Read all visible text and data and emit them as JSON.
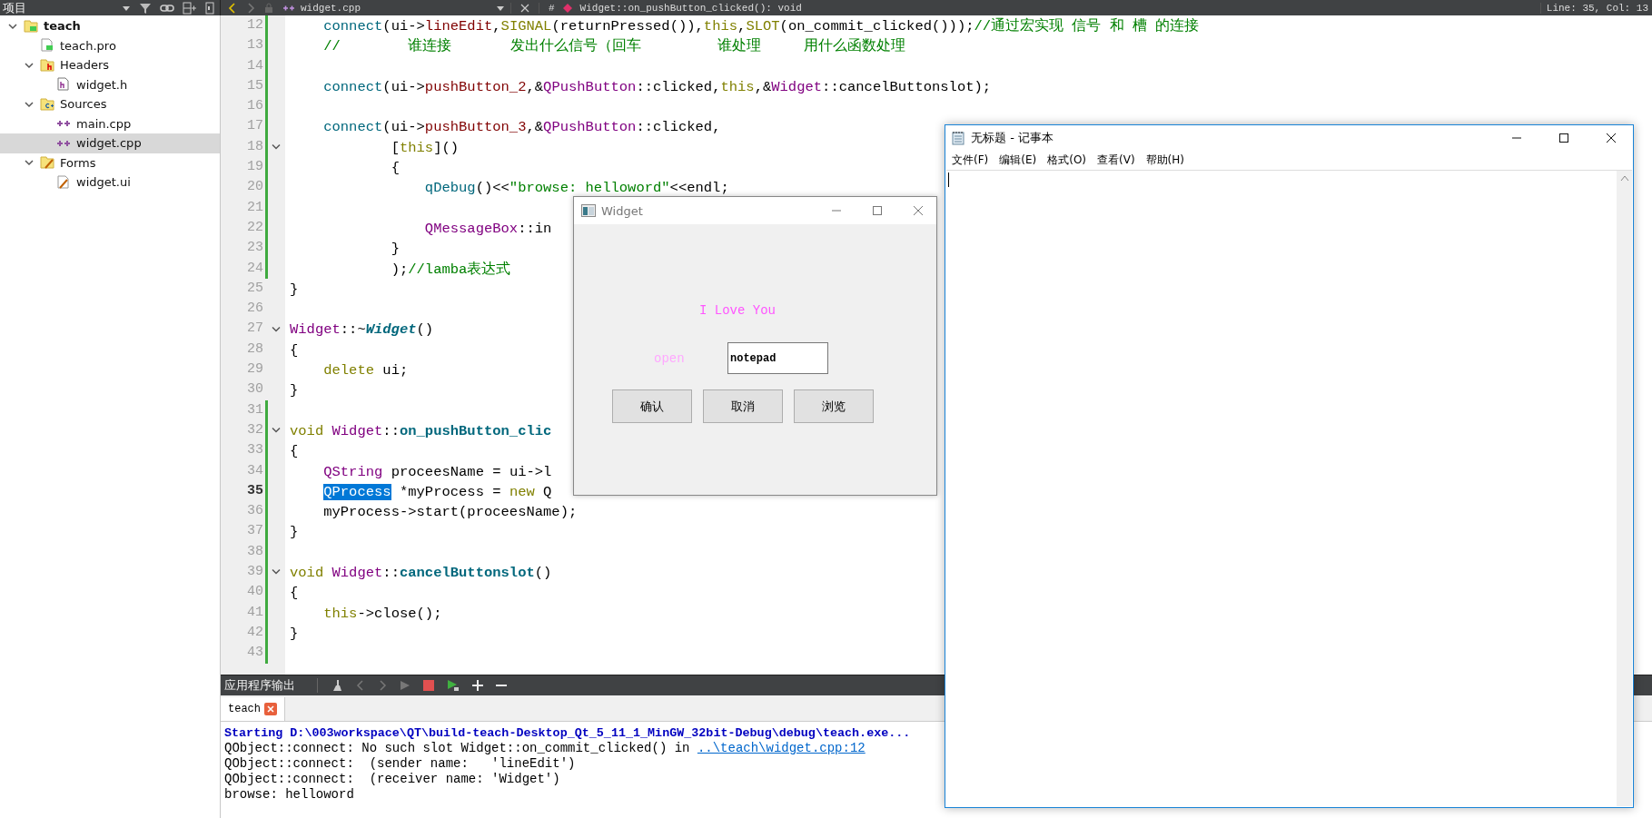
{
  "top_bar": {
    "sidebar_title": "项目",
    "file_name": "widget.cpp",
    "hash": "#",
    "symbol": "Widget::on_pushButton_clicked(): void",
    "cursor_position": "Line: 35, Col: 13"
  },
  "project_tree": [
    {
      "label": "teach",
      "kind": "project",
      "expanded": true,
      "selected": false,
      "children": [
        {
          "label": "teach.pro",
          "kind": "pro-file",
          "selected": false
        },
        {
          "label": "Headers",
          "kind": "header-folder",
          "expanded": true,
          "selected": false,
          "children": [
            {
              "label": "widget.h",
              "kind": "header-file",
              "selected": false
            }
          ]
        },
        {
          "label": "Sources",
          "kind": "source-folder",
          "expanded": true,
          "selected": false,
          "children": [
            {
              "label": "main.cpp",
              "kind": "source-file",
              "selected": false
            },
            {
              "label": "widget.cpp",
              "kind": "source-file",
              "selected": true
            }
          ]
        },
        {
          "label": "Forms",
          "kind": "form-folder",
          "expanded": true,
          "selected": false,
          "children": [
            {
              "label": "widget.ui",
              "kind": "form-file",
              "selected": false
            }
          ]
        }
      ]
    }
  ],
  "code_lines": [
    {
      "number": "12",
      "modified": true,
      "foldable": false,
      "current": false,
      "tokens": [
        {
          "text": "    connect",
          "kind": "function"
        },
        {
          "text": "(ui->",
          "kind": "plain"
        },
        {
          "text": "lineEdit",
          "kind": "member"
        },
        {
          "text": ",",
          "kind": "plain"
        },
        {
          "text": "SIGNAL",
          "kind": "macro"
        },
        {
          "text": "(returnPressed()),",
          "kind": "plain"
        },
        {
          "text": "this",
          "kind": "keyword"
        },
        {
          "text": ",",
          "kind": "plain"
        },
        {
          "text": "SLOT",
          "kind": "macro"
        },
        {
          "text": "(on_commit_clicked()));",
          "kind": "plain"
        },
        {
          "text": "//通过宏实现 信号 和 槽 的连接",
          "kind": "comment"
        }
      ]
    },
    {
      "number": "13",
      "modified": true,
      "foldable": false,
      "current": false,
      "tokens": [
        {
          "text": "    //        谁连接       发出什么信号（回车         谁处理     用什么函数处理",
          "kind": "comment"
        }
      ]
    },
    {
      "number": "14",
      "modified": true,
      "foldable": false,
      "current": false
    },
    {
      "number": "15",
      "modified": true,
      "foldable": false,
      "current": false,
      "tokens": [
        {
          "text": "    connect",
          "kind": "function"
        },
        {
          "text": "(ui->",
          "kind": "plain"
        },
        {
          "text": "pushButton_2",
          "kind": "member"
        },
        {
          "text": ",&",
          "kind": "plain"
        },
        {
          "text": "QPushButton",
          "kind": "type"
        },
        {
          "text": "::clicked,",
          "kind": "plain"
        },
        {
          "text": "this",
          "kind": "keyword"
        },
        {
          "text": ",&",
          "kind": "plain"
        },
        {
          "text": "Widget",
          "kind": "type"
        },
        {
          "text": "::cancelButtonslot);",
          "kind": "plain"
        }
      ]
    },
    {
      "number": "16",
      "modified": true,
      "foldable": false,
      "current": false
    },
    {
      "number": "17",
      "modified": true,
      "foldable": false,
      "current": false,
      "tokens": [
        {
          "text": "    connect",
          "kind": "function"
        },
        {
          "text": "(ui->",
          "kind": "plain"
        },
        {
          "text": "pushButton_3",
          "kind": "member"
        },
        {
          "text": ",&",
          "kind": "plain"
        },
        {
          "text": "QPushButton",
          "kind": "type"
        },
        {
          "text": "::clicked,",
          "kind": "plain"
        }
      ]
    },
    {
      "number": "18",
      "modified": true,
      "foldable": true,
      "current": false,
      "tokens": [
        {
          "text": "            [",
          "kind": "plain"
        },
        {
          "text": "this",
          "kind": "keyword"
        },
        {
          "text": "]()",
          "kind": "plain"
        }
      ]
    },
    {
      "number": "19",
      "modified": true,
      "foldable": false,
      "current": false,
      "tokens": [
        {
          "text": "            {",
          "kind": "plain"
        }
      ]
    },
    {
      "number": "20",
      "modified": true,
      "foldable": false,
      "current": false,
      "tokens": [
        {
          "text": "                qDebug",
          "kind": "function"
        },
        {
          "text": "()<<",
          "kind": "plain"
        },
        {
          "text": "\"browse: helloword\"",
          "kind": "string"
        },
        {
          "text": "<<endl;",
          "kind": "plain"
        }
      ]
    },
    {
      "number": "21",
      "modified": true,
      "foldable": false,
      "current": false
    },
    {
      "number": "22",
      "modified": true,
      "foldable": false,
      "current": false,
      "tokens": [
        {
          "text": "                QMessageBox",
          "kind": "type"
        },
        {
          "text": "::in",
          "kind": "plain"
        }
      ]
    },
    {
      "number": "23",
      "modified": true,
      "foldable": false,
      "current": false,
      "tokens": [
        {
          "text": "            }",
          "kind": "plain"
        }
      ]
    },
    {
      "number": "24",
      "modified": true,
      "foldable": false,
      "current": false,
      "tokens": [
        {
          "text": "            );",
          "kind": "plain"
        },
        {
          "text": "//lamba表达式",
          "kind": "comment"
        }
      ]
    },
    {
      "number": "25",
      "modified": false,
      "foldable": false,
      "current": false,
      "tokens": [
        {
          "text": "}",
          "kind": "plain"
        }
      ]
    },
    {
      "number": "26",
      "modified": false,
      "foldable": false,
      "current": false
    },
    {
      "number": "27",
      "modified": false,
      "foldable": true,
      "current": false,
      "tokens": [
        {
          "text": "Widget",
          "kind": "type"
        },
        {
          "text": "::~",
          "kind": "plain"
        },
        {
          "text": "Widget",
          "kind": "declaration-italic"
        },
        {
          "text": "()",
          "kind": "plain"
        }
      ]
    },
    {
      "number": "28",
      "modified": false,
      "foldable": false,
      "current": false,
      "tokens": [
        {
          "text": "{",
          "kind": "plain"
        }
      ]
    },
    {
      "number": "29",
      "modified": false,
      "foldable": false,
      "current": false,
      "tokens": [
        {
          "text": "    delete",
          "kind": "keyword"
        },
        {
          "text": " ui;",
          "kind": "plain"
        }
      ]
    },
    {
      "number": "30",
      "modified": false,
      "foldable": false,
      "current": false,
      "tokens": [
        {
          "text": "}",
          "kind": "plain"
        }
      ]
    },
    {
      "number": "31",
      "modified": true,
      "foldable": false,
      "current": false
    },
    {
      "number": "32",
      "modified": true,
      "foldable": true,
      "current": false,
      "tokens": [
        {
          "text": "void ",
          "kind": "keyword"
        },
        {
          "text": "Widget",
          "kind": "type"
        },
        {
          "text": "::",
          "kind": "plain"
        },
        {
          "text": "on_pushButton_clic",
          "kind": "declaration"
        }
      ]
    },
    {
      "number": "33",
      "modified": true,
      "foldable": false,
      "current": false,
      "tokens": [
        {
          "text": "{",
          "kind": "plain"
        }
      ]
    },
    {
      "number": "34",
      "modified": true,
      "foldable": false,
      "current": false,
      "tokens": [
        {
          "text": "    QString",
          "kind": "type"
        },
        {
          "text": " proceesName = ui->l",
          "kind": "plain"
        }
      ]
    },
    {
      "number": "35",
      "modified": true,
      "foldable": false,
      "current": true,
      "tokens": [
        {
          "text": "    QProcess",
          "kind": "selection"
        },
        {
          "text": " *myProcess = ",
          "kind": "plain"
        },
        {
          "text": "new",
          "kind": "keyword"
        },
        {
          "text": " Q",
          "kind": "plain"
        }
      ]
    },
    {
      "number": "36",
      "modified": true,
      "foldable": false,
      "current": false,
      "tokens": [
        {
          "text": "    myProcess->start(proceesName);",
          "kind": "plain"
        }
      ]
    },
    {
      "number": "37",
      "modified": true,
      "foldable": false,
      "current": false,
      "tokens": [
        {
          "text": "}",
          "kind": "plain"
        }
      ]
    },
    {
      "number": "38",
      "modified": true,
      "foldable": false,
      "current": false
    },
    {
      "number": "39",
      "modified": true,
      "foldable": true,
      "current": false,
      "tokens": [
        {
          "text": "void ",
          "kind": "keyword"
        },
        {
          "text": "Widget",
          "kind": "type"
        },
        {
          "text": "::",
          "kind": "plain"
        },
        {
          "text": "cancelButtonslot",
          "kind": "declaration"
        },
        {
          "text": "()",
          "kind": "plain"
        }
      ]
    },
    {
      "number": "40",
      "modified": true,
      "foldable": false,
      "current": false,
      "tokens": [
        {
          "text": "{",
          "kind": "plain"
        }
      ]
    },
    {
      "number": "41",
      "modified": true,
      "foldable": false,
      "current": false,
      "tokens": [
        {
          "text": "    this",
          "kind": "keyword"
        },
        {
          "text": "->close();",
          "kind": "plain"
        }
      ]
    },
    {
      "number": "42",
      "modified": true,
      "foldable": false,
      "current": false,
      "tokens": [
        {
          "text": "}",
          "kind": "plain"
        }
      ]
    },
    {
      "number": "43",
      "modified": true,
      "foldable": false,
      "current": false
    }
  ],
  "output_pane": {
    "title": "应用程序输出",
    "tabs": [
      {
        "label": "teach",
        "selected": true
      }
    ],
    "lines": [
      {
        "kind": "status",
        "text": "Starting D:\\003workspace\\QT\\build-teach-Desktop_Qt_5_11_1_MinGW_32bit-Debug\\debug\\teach.exe..."
      },
      {
        "kind": "normal",
        "text": "QObject::connect: No such slot Widget::on_commit_clicked() in ",
        "link": "..\\teach\\widget.cpp:12"
      },
      {
        "kind": "normal",
        "text": "QObject::connect:  (sender name:   'lineEdit')"
      },
      {
        "kind": "normal",
        "text": "QObject::connect:  (receiver name: 'Widget')"
      },
      {
        "kind": "normal",
        "text": "browse: helloword"
      }
    ]
  },
  "widget_dialog": {
    "title": "Widget",
    "heading": "I Love You",
    "field_label": "open",
    "field_value": "notepad",
    "buttons": [
      "确认",
      "取消",
      "浏览"
    ]
  },
  "notepad_window": {
    "title": "无标题 - 记事本",
    "menus": [
      "文件(F)",
      "编辑(E)",
      "格式(O)",
      "查看(V)",
      "帮助(H)"
    ]
  }
}
